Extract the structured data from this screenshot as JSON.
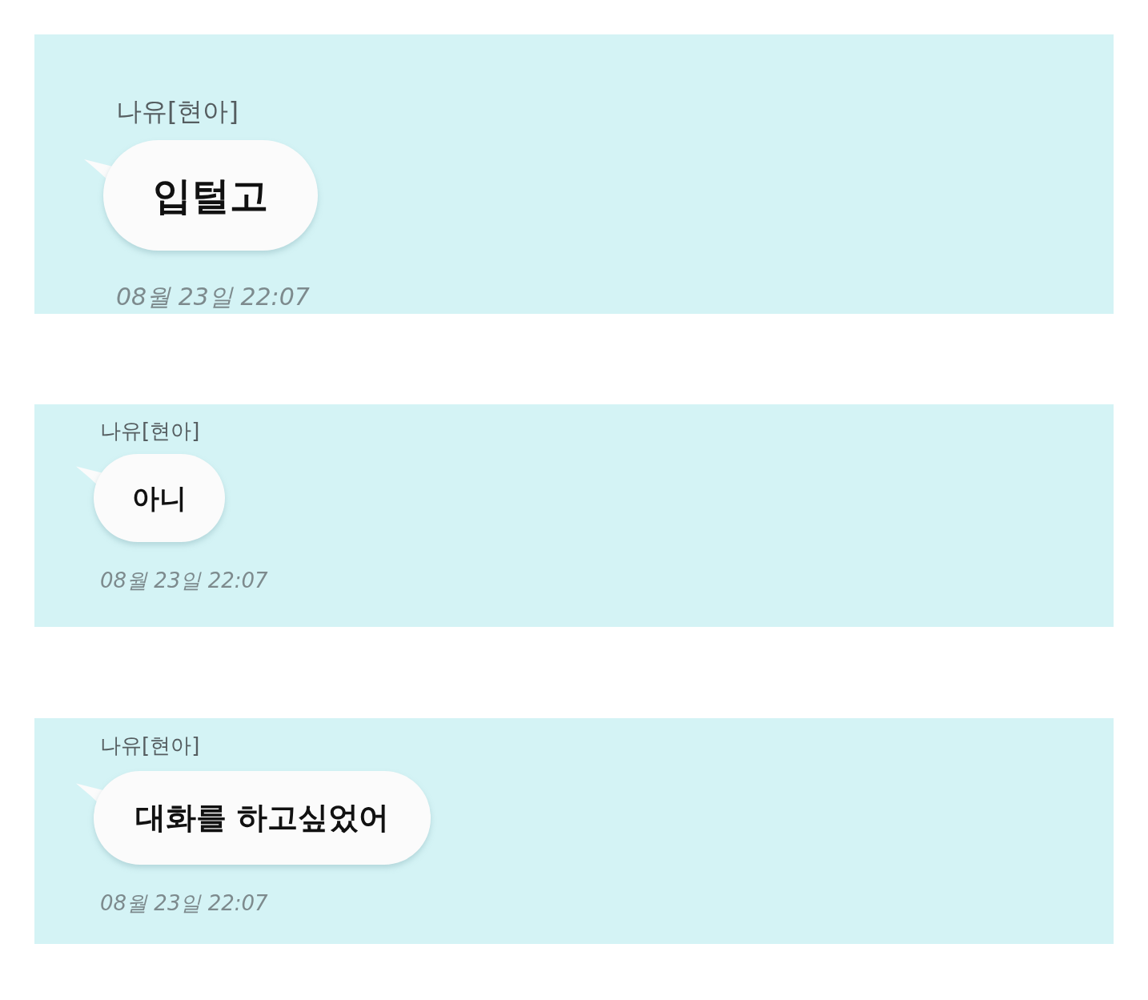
{
  "messages": [
    {
      "sender": "나유[현아]",
      "text": "입털고",
      "time": "08월 23일 22:07"
    },
    {
      "sender": "나유[현아]",
      "text": "아니",
      "time": "08월 23일 22:07"
    },
    {
      "sender": "나유[현아]",
      "text": "대화를 하고싶었어",
      "time": "08월 23일 22:07"
    }
  ]
}
